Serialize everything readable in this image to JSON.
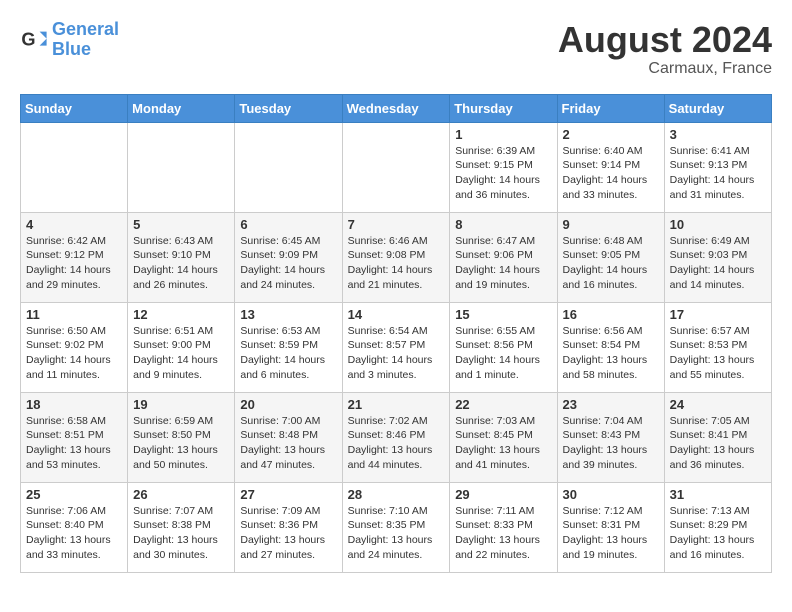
{
  "header": {
    "logo_line1": "General",
    "logo_line2": "Blue",
    "month_year": "August 2024",
    "location": "Carmaux, France"
  },
  "days_of_week": [
    "Sunday",
    "Monday",
    "Tuesday",
    "Wednesday",
    "Thursday",
    "Friday",
    "Saturday"
  ],
  "weeks": [
    [
      {
        "day": "",
        "info": ""
      },
      {
        "day": "",
        "info": ""
      },
      {
        "day": "",
        "info": ""
      },
      {
        "day": "",
        "info": ""
      },
      {
        "day": "1",
        "info": "Sunrise: 6:39 AM\nSunset: 9:15 PM\nDaylight: 14 hours\nand 36 minutes."
      },
      {
        "day": "2",
        "info": "Sunrise: 6:40 AM\nSunset: 9:14 PM\nDaylight: 14 hours\nand 33 minutes."
      },
      {
        "day": "3",
        "info": "Sunrise: 6:41 AM\nSunset: 9:13 PM\nDaylight: 14 hours\nand 31 minutes."
      }
    ],
    [
      {
        "day": "4",
        "info": "Sunrise: 6:42 AM\nSunset: 9:12 PM\nDaylight: 14 hours\nand 29 minutes."
      },
      {
        "day": "5",
        "info": "Sunrise: 6:43 AM\nSunset: 9:10 PM\nDaylight: 14 hours\nand 26 minutes."
      },
      {
        "day": "6",
        "info": "Sunrise: 6:45 AM\nSunset: 9:09 PM\nDaylight: 14 hours\nand 24 minutes."
      },
      {
        "day": "7",
        "info": "Sunrise: 6:46 AM\nSunset: 9:08 PM\nDaylight: 14 hours\nand 21 minutes."
      },
      {
        "day": "8",
        "info": "Sunrise: 6:47 AM\nSunset: 9:06 PM\nDaylight: 14 hours\nand 19 minutes."
      },
      {
        "day": "9",
        "info": "Sunrise: 6:48 AM\nSunset: 9:05 PM\nDaylight: 14 hours\nand 16 minutes."
      },
      {
        "day": "10",
        "info": "Sunrise: 6:49 AM\nSunset: 9:03 PM\nDaylight: 14 hours\nand 14 minutes."
      }
    ],
    [
      {
        "day": "11",
        "info": "Sunrise: 6:50 AM\nSunset: 9:02 PM\nDaylight: 14 hours\nand 11 minutes."
      },
      {
        "day": "12",
        "info": "Sunrise: 6:51 AM\nSunset: 9:00 PM\nDaylight: 14 hours\nand 9 minutes."
      },
      {
        "day": "13",
        "info": "Sunrise: 6:53 AM\nSunset: 8:59 PM\nDaylight: 14 hours\nand 6 minutes."
      },
      {
        "day": "14",
        "info": "Sunrise: 6:54 AM\nSunset: 8:57 PM\nDaylight: 14 hours\nand 3 minutes."
      },
      {
        "day": "15",
        "info": "Sunrise: 6:55 AM\nSunset: 8:56 PM\nDaylight: 14 hours\nand 1 minute."
      },
      {
        "day": "16",
        "info": "Sunrise: 6:56 AM\nSunset: 8:54 PM\nDaylight: 13 hours\nand 58 minutes."
      },
      {
        "day": "17",
        "info": "Sunrise: 6:57 AM\nSunset: 8:53 PM\nDaylight: 13 hours\nand 55 minutes."
      }
    ],
    [
      {
        "day": "18",
        "info": "Sunrise: 6:58 AM\nSunset: 8:51 PM\nDaylight: 13 hours\nand 53 minutes."
      },
      {
        "day": "19",
        "info": "Sunrise: 6:59 AM\nSunset: 8:50 PM\nDaylight: 13 hours\nand 50 minutes."
      },
      {
        "day": "20",
        "info": "Sunrise: 7:00 AM\nSunset: 8:48 PM\nDaylight: 13 hours\nand 47 minutes."
      },
      {
        "day": "21",
        "info": "Sunrise: 7:02 AM\nSunset: 8:46 PM\nDaylight: 13 hours\nand 44 minutes."
      },
      {
        "day": "22",
        "info": "Sunrise: 7:03 AM\nSunset: 8:45 PM\nDaylight: 13 hours\nand 41 minutes."
      },
      {
        "day": "23",
        "info": "Sunrise: 7:04 AM\nSunset: 8:43 PM\nDaylight: 13 hours\nand 39 minutes."
      },
      {
        "day": "24",
        "info": "Sunrise: 7:05 AM\nSunset: 8:41 PM\nDaylight: 13 hours\nand 36 minutes."
      }
    ],
    [
      {
        "day": "25",
        "info": "Sunrise: 7:06 AM\nSunset: 8:40 PM\nDaylight: 13 hours\nand 33 minutes."
      },
      {
        "day": "26",
        "info": "Sunrise: 7:07 AM\nSunset: 8:38 PM\nDaylight: 13 hours\nand 30 minutes."
      },
      {
        "day": "27",
        "info": "Sunrise: 7:09 AM\nSunset: 8:36 PM\nDaylight: 13 hours\nand 27 minutes."
      },
      {
        "day": "28",
        "info": "Sunrise: 7:10 AM\nSunset: 8:35 PM\nDaylight: 13 hours\nand 24 minutes."
      },
      {
        "day": "29",
        "info": "Sunrise: 7:11 AM\nSunset: 8:33 PM\nDaylight: 13 hours\nand 22 minutes."
      },
      {
        "day": "30",
        "info": "Sunrise: 7:12 AM\nSunset: 8:31 PM\nDaylight: 13 hours\nand 19 minutes."
      },
      {
        "day": "31",
        "info": "Sunrise: 7:13 AM\nSunset: 8:29 PM\nDaylight: 13 hours\nand 16 minutes."
      }
    ]
  ]
}
